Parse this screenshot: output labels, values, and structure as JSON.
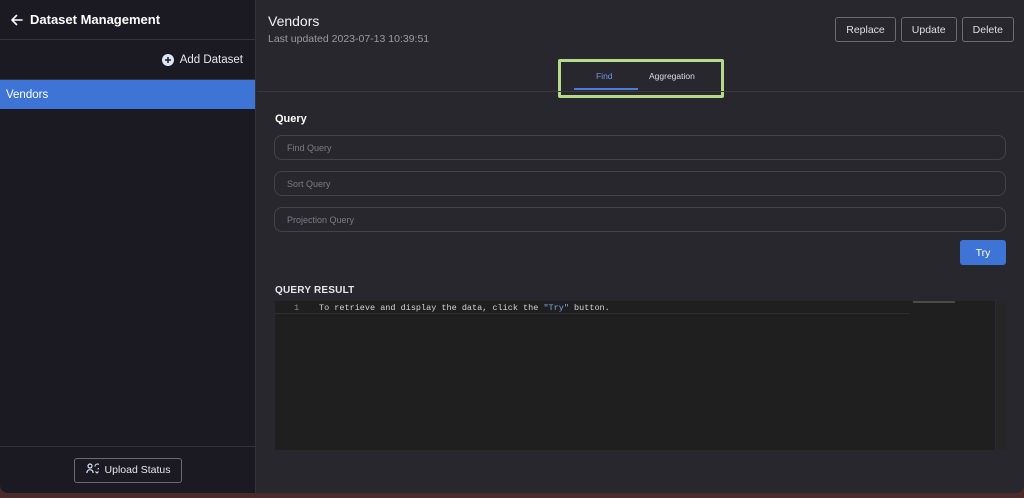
{
  "sidebar": {
    "title": "Dataset Management",
    "add_dataset_label": "Add Dataset",
    "items": [
      {
        "label": "Vendors"
      }
    ],
    "upload_status_label": "Upload Status"
  },
  "main": {
    "title": "Vendors",
    "last_updated": "Last updated 2023-07-13 10:39:51",
    "actions": {
      "replace": "Replace",
      "update": "Update",
      "delete": "Delete"
    },
    "tabs": [
      {
        "label": "Find",
        "active": true
      },
      {
        "label": "Aggregation",
        "active": false
      }
    ],
    "query": {
      "section_label": "Query",
      "find_placeholder": "Find Query",
      "sort_placeholder": "Sort Query",
      "projection_placeholder": "Projection Query",
      "try_label": "Try"
    },
    "result": {
      "label": "QUERY RESULT",
      "line_number": "1",
      "line_before": "To retrieve and display the data, click the ",
      "line_string": "\"Try\"",
      "line_after": " button."
    }
  },
  "colors": {
    "accent": "#3d74d6",
    "sidebar_bg": "#1b1a23",
    "main_bg": "#28272e",
    "highlight_box": "#b7d98c"
  },
  "icons": {
    "back": "arrow-left-icon",
    "add": "plus-circle-icon",
    "upload_status": "people-sync-icon"
  }
}
